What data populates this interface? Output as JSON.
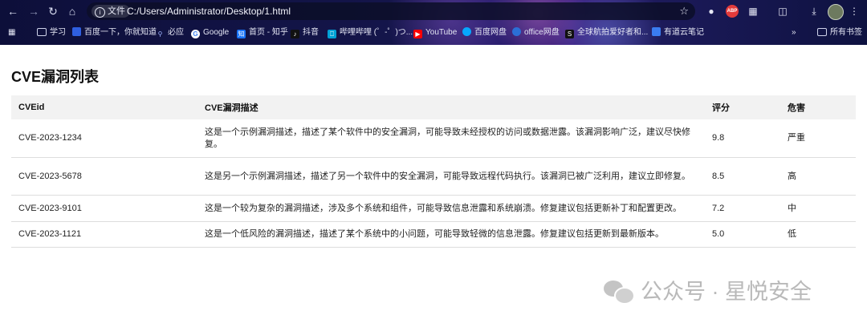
{
  "browser": {
    "info_label": "文件",
    "url": "C:/Users/Administrator/Desktop/1.html",
    "bookmarks": [
      {
        "label": "学习"
      },
      {
        "label": "百度一下，你就知道"
      },
      {
        "label": "必应"
      },
      {
        "label": "Google"
      },
      {
        "label": "首页 - 知乎"
      },
      {
        "label": "抖音"
      },
      {
        "label": "哔哩哔哩 (゜-゜)つ..."
      },
      {
        "label": "YouTube"
      },
      {
        "label": "百度网盘"
      },
      {
        "label": "office网盘"
      },
      {
        "label": "全球航拍爱好者和..."
      },
      {
        "label": "有道云笔记"
      }
    ],
    "more_label": "»",
    "all_bookmarks_label": "所有书签"
  },
  "page": {
    "title": "CVE漏洞列表",
    "table": {
      "headers": [
        "CVEid",
        "CVE漏洞描述",
        "评分",
        "危害"
      ],
      "rows": [
        {
          "id": "CVE-2023-1234",
          "desc": "这是一个示例漏洞描述，描述了某个软件中的安全漏洞，可能导致未经授权的访问或数据泄露。该漏洞影响广泛，建议尽快修复。",
          "score": "9.8",
          "severity": "严重"
        },
        {
          "id": "CVE-2023-5678",
          "desc": "这是另一个示例漏洞描述，描述了另一个软件中的安全漏洞，可能导致远程代码执行。该漏洞已被广泛利用，建议立即修复。",
          "score": "8.5",
          "severity": "高"
        },
        {
          "id": "CVE-2023-9101",
          "desc": "这是一个较为复杂的漏洞描述，涉及多个系统和组件，可能导致信息泄露和系统崩溃。修复建议包括更新补丁和配置更改。",
          "score": "7.2",
          "severity": "中"
        },
        {
          "id": "CVE-2023-1121",
          "desc": "这是一个低风险的漏洞描述，描述了某个系统中的小问题，可能导致轻微的信息泄露。修复建议包括更新到最新版本。",
          "score": "5.0",
          "severity": "低"
        }
      ]
    }
  },
  "watermark": {
    "text": "公众号 · 星悦安全"
  }
}
